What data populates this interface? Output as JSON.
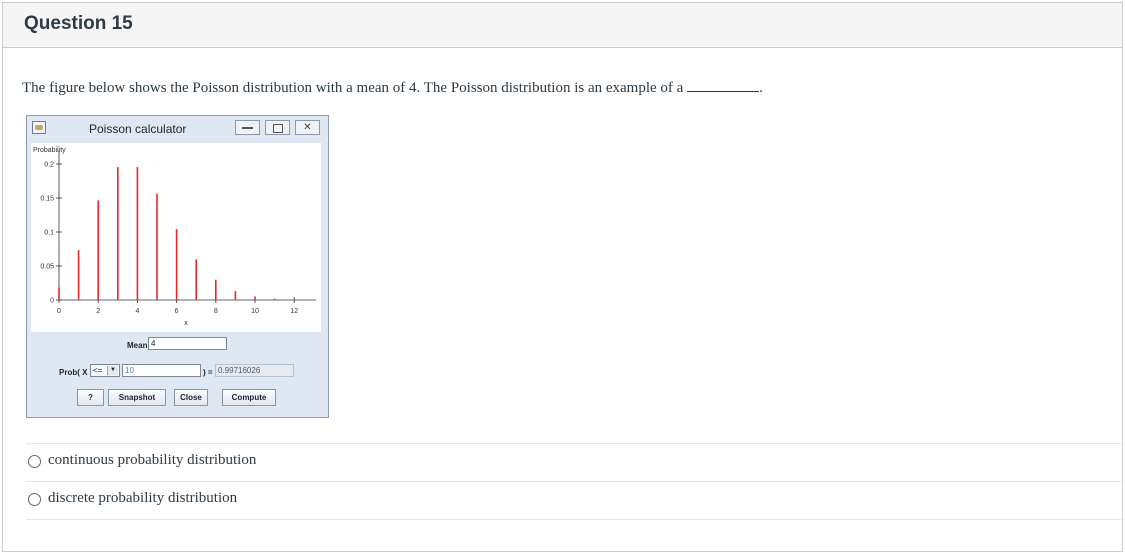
{
  "question": {
    "title": "Question 15",
    "text": "The figure below shows the Poisson distribution with a mean of 4. The Poisson distribution is an example of a"
  },
  "window": {
    "title": "Poisson calculator"
  },
  "chart_data": {
    "type": "bar",
    "ylabel": "Probability",
    "xlabel": "x",
    "xlim": [
      0,
      13
    ],
    "ylim": [
      0,
      0.2
    ],
    "xticks": [
      "0",
      "2",
      "4",
      "6",
      "8",
      "10",
      "12"
    ],
    "yticks": [
      "0.2",
      "0.15",
      "0.1",
      "0.05",
      "0"
    ],
    "color": "#e8282b",
    "x": [
      0,
      1,
      2,
      3,
      4,
      5,
      6,
      7,
      8,
      9,
      10,
      11,
      12,
      13
    ],
    "values": [
      0.0183,
      0.0733,
      0.1465,
      0.1954,
      0.1954,
      0.1563,
      0.1042,
      0.0595,
      0.0298,
      0.0132,
      0.0053,
      0.0019,
      0.0006,
      0.0002
    ]
  },
  "calculator": {
    "mean_label": "Mean:",
    "mean_value": "4",
    "prob_label": "Prob( X",
    "operator": "<=",
    "x_value": "10",
    "equals_label": ") =",
    "result": "0.99716026",
    "buttons": {
      "help": "?",
      "snapshot": "Snapshot",
      "close": "Close",
      "compute": "Compute"
    }
  },
  "options": [
    {
      "label": "continuous probability distribution"
    },
    {
      "label": "discrete probability distribution"
    }
  ]
}
